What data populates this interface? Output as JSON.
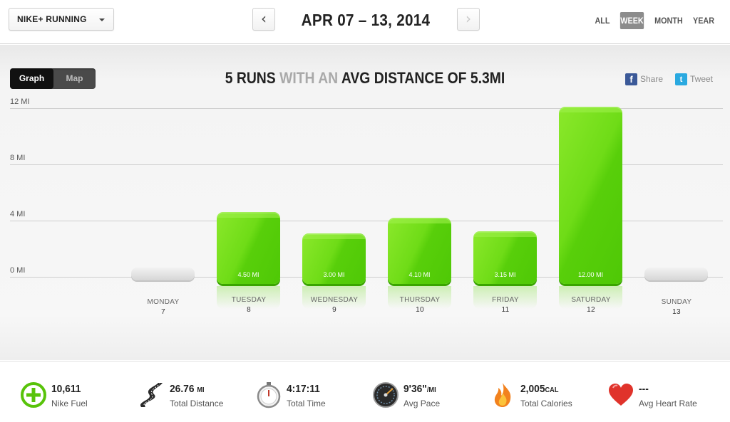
{
  "header": {
    "app_select": "NIKE+ RUNNING",
    "prev_glyph": "‹",
    "next_glyph": "›",
    "date_range": "APR 07 – 13, 2014",
    "periods": [
      "ALL",
      "WEEK",
      "MONTH",
      "YEAR"
    ],
    "selected_period": "WEEK"
  },
  "view_toggle": {
    "graph": "Graph",
    "map": "Map",
    "selected": "Graph"
  },
  "summary": {
    "part1": "5 RUNS",
    "part2": " WITH AN ",
    "part3": "AVG DISTANCE OF 5.3MI"
  },
  "social": {
    "share": "Share",
    "tweet": "Tweet",
    "share_glyph": "f",
    "tweet_glyph": "t"
  },
  "chart_data": {
    "type": "bar",
    "unit": "MI",
    "y_ticks": [
      "12 MI",
      "8 MI",
      "4 MI",
      "0 MI"
    ],
    "y_tick_values": [
      12,
      8,
      4,
      0
    ],
    "ylim": [
      0,
      12
    ],
    "days": [
      {
        "name": "MONDAY",
        "date": "7",
        "value": null,
        "label": ""
      },
      {
        "name": "TUESDAY",
        "date": "8",
        "value": 4.5,
        "label": "4.50 MI"
      },
      {
        "name": "WEDNESDAY",
        "date": "9",
        "value": 3.0,
        "label": "3.00 MI"
      },
      {
        "name": "THURSDAY",
        "date": "10",
        "value": 4.1,
        "label": "4.10 MI"
      },
      {
        "name": "FRIDAY",
        "date": "11",
        "value": 3.15,
        "label": "3.15 MI"
      },
      {
        "name": "SATURDAY",
        "date": "12",
        "value": 12.0,
        "label": "12.00 MI"
      },
      {
        "name": "SUNDAY",
        "date": "13",
        "value": null,
        "label": ""
      }
    ]
  },
  "stats": {
    "fuel": {
      "value": "10,611",
      "unit": "",
      "label": "Nike Fuel",
      "icon": "nike-fuel-plus-icon"
    },
    "distance": {
      "value": "26.76",
      "unit": "MI",
      "label": "Total Distance",
      "icon": "road-icon"
    },
    "time": {
      "value": "4:17:11",
      "unit": "",
      "label": "Total Time",
      "icon": "stopwatch-icon"
    },
    "pace": {
      "value": "9'36\"",
      "unit": "/MI",
      "label": "Avg Pace",
      "icon": "speedometer-icon"
    },
    "calories": {
      "value": "2,005",
      "unit": "CAL",
      "label": "Total Calories",
      "icon": "flame-icon"
    },
    "heart": {
      "value": "---",
      "unit": "",
      "label": "Avg Heart Rate",
      "icon": "heart-icon"
    }
  },
  "colors": {
    "bar_green": "#6fdc17",
    "fuel_green": "#58c30a",
    "heart_red": "#e0332b",
    "flame_orange": "#f2821e",
    "facebook_blue": "#3b5998",
    "twitter_blue": "#2aa9e0"
  }
}
